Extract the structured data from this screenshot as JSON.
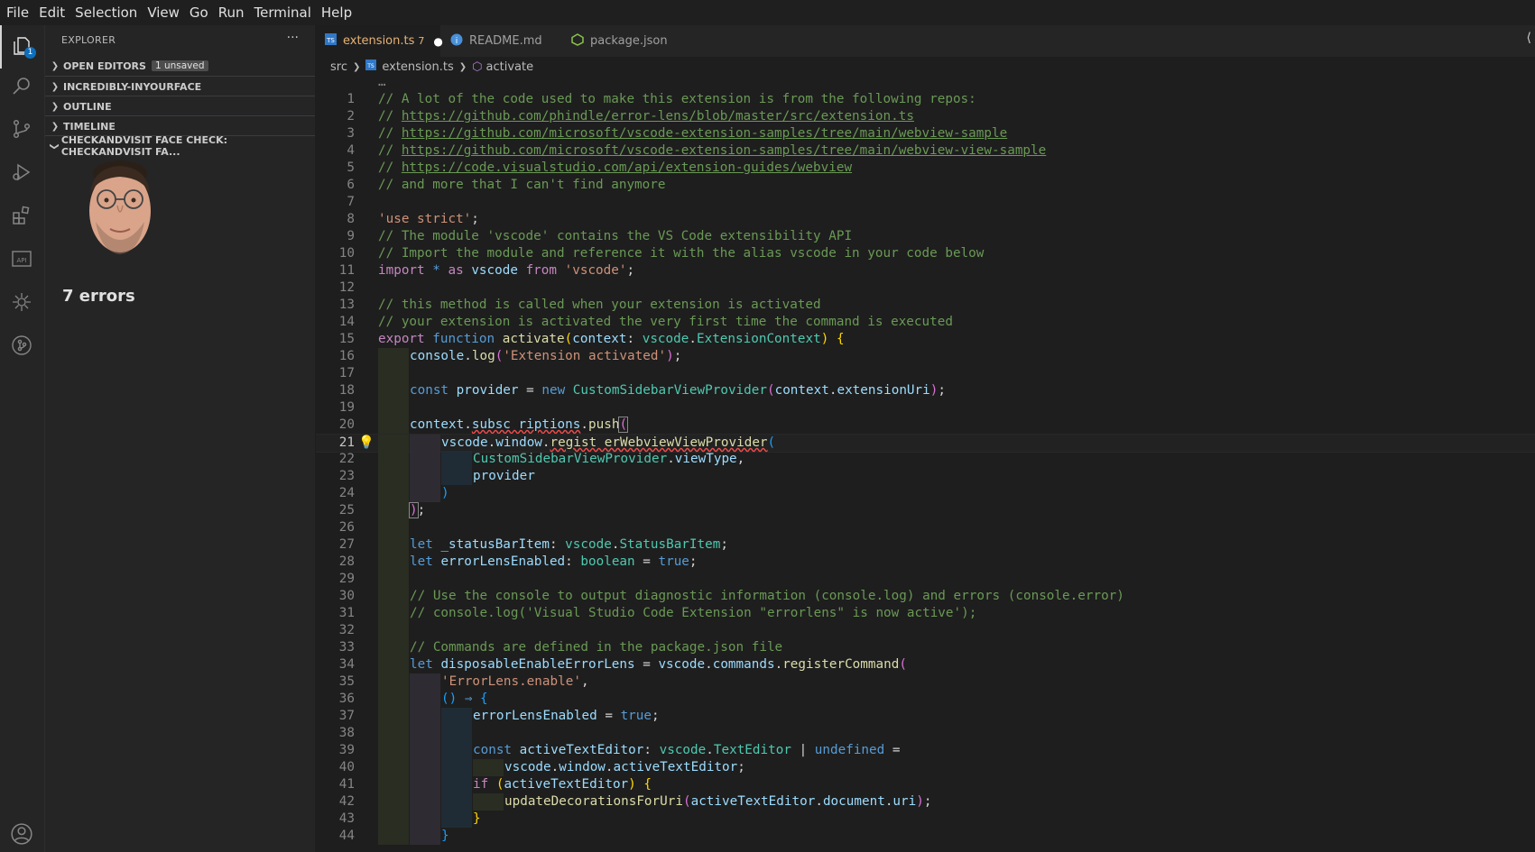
{
  "menu": [
    "File",
    "Edit",
    "Selection",
    "View",
    "Go",
    "Run",
    "Terminal",
    "Help"
  ],
  "activity": {
    "icons": [
      "files-icon",
      "search-icon",
      "source-control-icon",
      "run-debug-icon",
      "extensions-icon",
      "api-icon",
      "extension-view-icon",
      "git-graph-icon",
      "account-icon"
    ],
    "badge": "1"
  },
  "sidebar": {
    "title": "EXPLORER",
    "more": "···",
    "sections": [
      {
        "label": "OPEN EDITORS",
        "badge": "1 unsaved",
        "expanded": false
      },
      {
        "label": "INCREDIBLY-INYOURFACE",
        "expanded": false
      },
      {
        "label": "OUTLINE",
        "expanded": false
      },
      {
        "label": "TIMELINE",
        "expanded": false
      },
      {
        "label": "CHECKANDVISIT FACE CHECK: CHECKANDVISIT FA...",
        "expanded": true
      }
    ],
    "errors_text": "7 errors"
  },
  "tabs": [
    {
      "label": "extension.ts",
      "problems": "7",
      "dirty": "●",
      "active": true,
      "icon": "ts-icon"
    },
    {
      "label": "README.md",
      "active": false,
      "icon": "info-icon"
    },
    {
      "label": "package.json",
      "active": false,
      "icon": "json-icon"
    }
  ],
  "breadcrumb": {
    "folder": "src",
    "file": "extension.ts",
    "symbol": "activate"
  },
  "colors": {
    "accent": "#0e6ebc",
    "tab_active_text": "#e8b275",
    "error": "#f14c4c"
  }
}
